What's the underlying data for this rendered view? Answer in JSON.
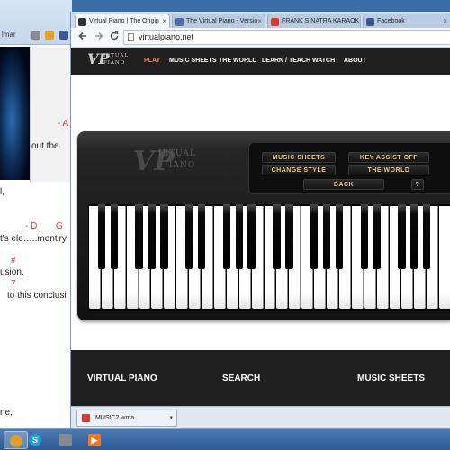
{
  "background_window": {
    "address_fragment": "lmar",
    "lines": [
      {
        "text": "- A",
        "color": "#e53333"
      },
      {
        "text": "out the",
        "color": "#222222"
      },
      {
        "text": "l,",
        "color": "#222222"
      },
      {
        "text": "- D",
        "color": "#e53333"
      },
      {
        "text": "G",
        "color": "#e53333"
      },
      {
        "text": "t's ele…..ment'ry",
        "color": "#222222"
      },
      {
        "text": "#",
        "color": "#e53333"
      },
      {
        "text": "usion.",
        "color": "#222222"
      },
      {
        "text": "7",
        "color": "#e53333"
      },
      {
        "text": "to this conclusi",
        "color": "#222222"
      },
      {
        "text": "ne,",
        "color": "#222222"
      }
    ]
  },
  "tabs": [
    {
      "label": "Virtual Piano | The Origin",
      "active": true,
      "favicon_color": "#333333"
    },
    {
      "label": "The Virtual Piano - Versio",
      "active": false,
      "favicon_color": "#4a6fa5"
    },
    {
      "label": "FRANK SINATRA KARAOK",
      "active": false,
      "favicon_color": "#e03a2f"
    },
    {
      "label": "Facebook",
      "active": false,
      "favicon_color": "#3b5998"
    }
  ],
  "toolbar": {
    "back_icon": "arrow-left-icon",
    "forward_icon": "arrow-right-icon",
    "reload_icon": "reload-icon",
    "url": "virtualpiano.net"
  },
  "site": {
    "logo_text": "IRTUAL PIANO",
    "logo_mark": "VP",
    "nav": [
      {
        "label": "PLAY",
        "active": true
      },
      {
        "label": "MUSIC SHEETS",
        "active": false
      },
      {
        "label": "THE WORLD",
        "active": false
      },
      {
        "label": "LEARN / TEACH",
        "active": false
      },
      {
        "label": "WATCH",
        "active": false
      },
      {
        "label": "ABOUT",
        "active": false
      }
    ],
    "piano_logo": {
      "mark": "VP",
      "word1": "IRTUAL",
      "word2": "IANO"
    },
    "controls": {
      "music_sheets": "MUSIC SHEETS",
      "key_assist": "KEY ASSIST OFF",
      "change_style": "CHANGE STYLE",
      "the_world": "THE WORLD",
      "back": "BACK",
      "help": "?"
    },
    "keyboard": {
      "white_key_count": 29,
      "black_key_pattern": [
        1,
        1,
        0,
        1,
        1,
        1,
        0
      ]
    },
    "footer": [
      "VIRTUAL PIANO",
      "SEARCH",
      "MUSIC SHEETS"
    ]
  },
  "downloads": {
    "file_name": "MUSIC2.wma"
  },
  "taskbar": [
    {
      "icon": "chrome-icon",
      "color": "#e0a020",
      "active": true
    },
    {
      "icon": "skype-icon",
      "color": "#1aa3e0",
      "active": false
    },
    {
      "icon": "tool-icon",
      "color": "#8a8a8a",
      "active": false
    },
    {
      "icon": "media-player-icon",
      "color": "#f07a20",
      "active": false
    }
  ],
  "colors": {
    "accent_nav": "#f0892d",
    "control_text": "#e8c57a",
    "site_dark": "#202020"
  }
}
